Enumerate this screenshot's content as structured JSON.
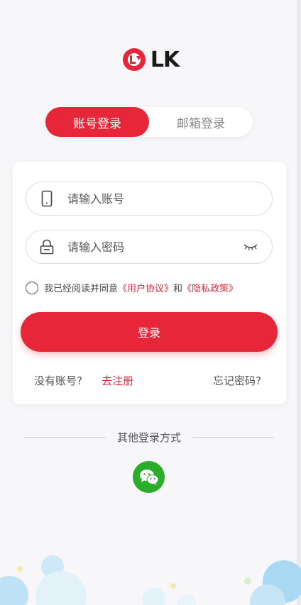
{
  "logo": {
    "text": "LK"
  },
  "tabs": [
    {
      "label": "账号登录",
      "active": true
    },
    {
      "label": "邮箱登录",
      "active": false
    }
  ],
  "form": {
    "account_placeholder": "请输入账号",
    "password_placeholder": "请输入密码",
    "agree_prefix": "我已经阅读并同意",
    "user_agreement": "《用户协议》",
    "and_text": "和",
    "privacy_policy": "《隐私政策》",
    "login_label": "登录",
    "no_account": "没有账号?",
    "register": "去注册",
    "forgot": "忘记密码?"
  },
  "other_login": {
    "label": "其他登录方式"
  },
  "colors": {
    "accent": "#e8263a",
    "wechat": "#2aae2a"
  },
  "icons": [
    "logo-mark-icon",
    "phone-icon",
    "lock-icon",
    "eye-closed-icon",
    "wechat-icon"
  ]
}
